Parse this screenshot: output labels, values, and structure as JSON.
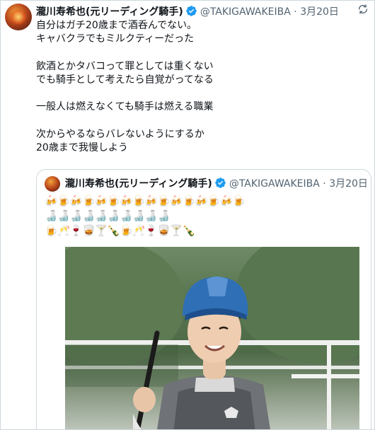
{
  "tweet": {
    "display_name": "瀧川寿希也(元リーディング騎手)",
    "handle": "@TAKIGAWAKEIBA",
    "date": "3月20日",
    "separator": "·",
    "text": "自分はガチ20歳まで酒呑んでない。\nキャバクラでもミルクティーだった\n\n飲酒とかタバコって罪としては重くない\nでも騎手として考えたら自覚がってなる\n\n一般人は燃えなくても騎手は燃える職業\n\n次からやるならバレないようにするか\n20歳まで我慢しよう",
    "verified": true,
    "icons": {
      "avatar": "profile-avatar",
      "verified": "verified-badge-icon",
      "sync": "sync-icon"
    }
  },
  "quoted_tweet": {
    "display_name": "瀧川寿希也(元リーディング騎手)",
    "handle": "@TAKIGAWAKEIBA",
    "date": "3月20日",
    "separator": "·",
    "emoji_text": "🍻🍺🍻🍺🍻🍺🍻🍺🍻🍺🍻🍺🍻🍺🍻🍺\n🍶🍶🍶🍶🍶🍶🍶🍶🍶🍶\n🍺🥂🍷🥃🍸🍾🍺🥂🍷🥃🍸🍾",
    "photo": "jockey-photo"
  },
  "colors": {
    "accent": "#1d9bf0",
    "muted": "#536471",
    "border": "#cfd9de",
    "text": "#0f1419"
  }
}
